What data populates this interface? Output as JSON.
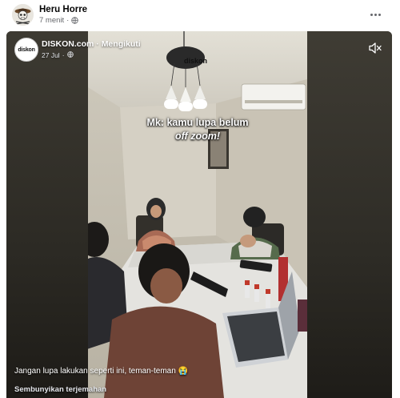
{
  "post": {
    "author": "Heru Horre",
    "time": "7 menit",
    "separator": "·",
    "avatar_icon": "pirate-skull-icon",
    "privacy_icon": "globe-icon",
    "more_icon": "more-horizontal-icon"
  },
  "reel": {
    "page_name": "DISKON.com",
    "dot": "·",
    "follow_status": "Mengikuti",
    "date": "27 Jul",
    "page_logo": "diskon",
    "video_logo": "diskon",
    "video_overlay_line1": "Mk: kamu lupa belum",
    "video_overlay_line2": "off zoom!",
    "caption": "Jangan lupa lakukan seperti ini, teman-teman 😭",
    "translate_toggle": "Sembunyikan terjemahan",
    "mute_icon": "speaker-muted-icon"
  }
}
